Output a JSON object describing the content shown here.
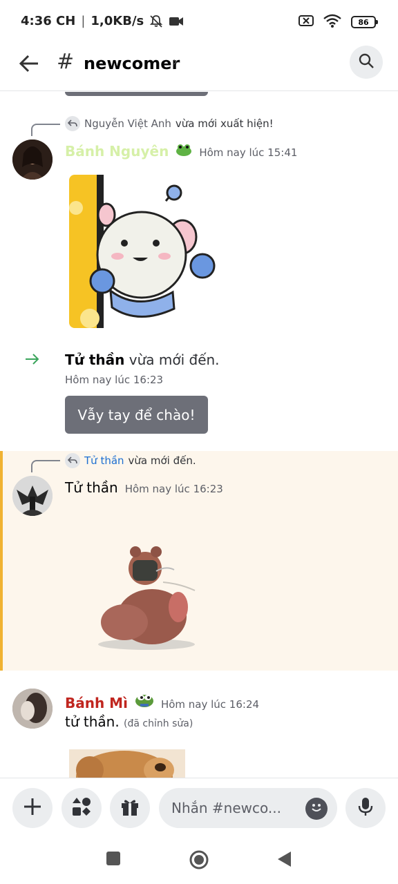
{
  "status_bar": {
    "time": "4:36 CH",
    "separator": "|",
    "speed": "1,0KB/s",
    "battery": "86"
  },
  "header": {
    "channel_name": "newcomer",
    "hash_symbol": "#",
    "chevron": "›",
    "icons": {
      "back": "arrow-left-icon",
      "search": "search-icon"
    }
  },
  "messages": [
    {
      "reply": {
        "name": "Nguyễn Việt Anh",
        "text": "vừa mới xuất hiện!"
      },
      "author": "Bánh Nguyên",
      "author_color": "#d6f0a8",
      "badge": "frog-emoji",
      "timestamp": "Hôm nay lúc 15:41",
      "attachment": "mouse-sticker"
    },
    {
      "join": true,
      "name": "Tử thần",
      "text": "vừa mới đến.",
      "timestamp": "Hôm nay lúc 16:23",
      "wave_button": "Vẫy tay để chào!"
    },
    {
      "reply": {
        "name": "Tử thần",
        "text": "vừa mới đến."
      },
      "author": "Tử thần",
      "author_color": "#060607",
      "timestamp": "Hôm nay lúc 16:23",
      "attachment": "bear-sticker",
      "highlighted": true
    },
    {
      "author": "Bánh Mì",
      "author_color": "#c0261f",
      "badge": "pepe-emoji",
      "timestamp": "Hôm nay lúc 16:24",
      "content": "tử thần.",
      "edited": "(đã chỉnh sửa)",
      "attachment": "cat-gif"
    }
  ],
  "composer": {
    "placeholder": "Nhắn #newco..."
  },
  "colors": {
    "highlight_bg": "#fdf6ec",
    "highlight_border": "#f0b232",
    "button_gray": "#6d6f78"
  }
}
